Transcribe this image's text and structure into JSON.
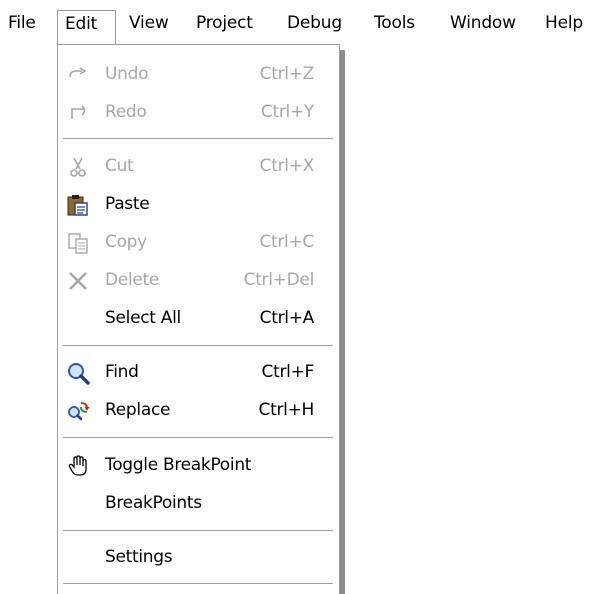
{
  "menubar": {
    "items": [
      {
        "label": "File"
      },
      {
        "label": "Edit"
      },
      {
        "label": "View"
      },
      {
        "label": "Project"
      },
      {
        "label": "Debug"
      },
      {
        "label": "Tools"
      },
      {
        "label": "Window"
      },
      {
        "label": "Help"
      }
    ]
  },
  "edit_menu": {
    "items": [
      {
        "label": "Undo",
        "shortcut": "Ctrl+Z",
        "icon": "undo-icon",
        "enabled": false
      },
      {
        "label": "Redo",
        "shortcut": "Ctrl+Y",
        "icon": "redo-icon",
        "enabled": false
      },
      {
        "label": "Cut",
        "shortcut": "Ctrl+X",
        "icon": "scissors-icon",
        "enabled": false
      },
      {
        "label": "Paste",
        "shortcut": "",
        "icon": "clipboard-icon",
        "enabled": true
      },
      {
        "label": "Copy",
        "shortcut": "Ctrl+C",
        "icon": "copy-icon",
        "enabled": false
      },
      {
        "label": "Delete",
        "shortcut": "Ctrl+Del",
        "icon": "delete-x-icon",
        "enabled": false
      },
      {
        "label": "Select All",
        "shortcut": "Ctrl+A",
        "icon": "",
        "enabled": true
      },
      {
        "label": "Find",
        "shortcut": "Ctrl+F",
        "icon": "magnifier-icon",
        "enabled": true
      },
      {
        "label": "Replace",
        "shortcut": "Ctrl+H",
        "icon": "replace-icon",
        "enabled": true
      },
      {
        "label": "Toggle BreakPoint",
        "shortcut": "",
        "icon": "hand-icon",
        "enabled": true
      },
      {
        "label": "BreakPoints",
        "shortcut": "",
        "icon": "",
        "enabled": true
      },
      {
        "label": "Settings",
        "shortcut": "",
        "icon": "",
        "enabled": true
      }
    ]
  },
  "colors": {
    "disabled_text": "#a7a6aa",
    "menu_border": "#9c9c9c",
    "shadow": "#8c8c8c"
  }
}
